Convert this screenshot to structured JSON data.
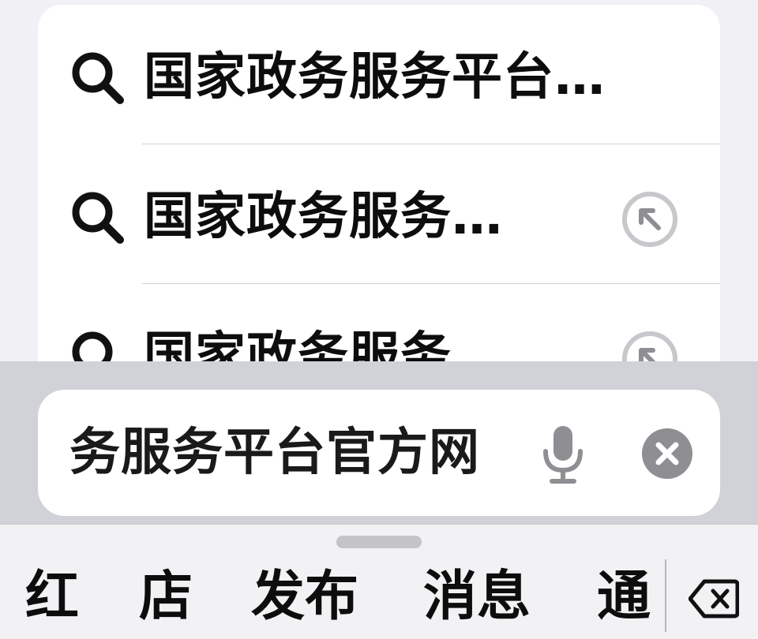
{
  "suggestions": [
    {
      "text": "国家政务服务平台…",
      "icon": "search-icon",
      "has_fill_arrow": false
    },
    {
      "text": "国家政务服务…",
      "icon": "search-icon",
      "has_fill_arrow": true
    },
    {
      "text": "国家政务服务",
      "icon": "search-icon",
      "has_fill_arrow": true
    }
  ],
  "search_field": {
    "value": "务服务平台官方网",
    "mic_icon": "microphone-icon",
    "clear_icon": "clear-icon"
  },
  "keyboard_candidates": {
    "items": [
      "红",
      "店",
      "发布",
      "消息",
      "通"
    ],
    "backspace_icon": "backspace-icon"
  },
  "colors": {
    "background": "#f0f0f5",
    "card": "#ffffff",
    "panel": "#d1d2d8",
    "icon_gray": "#8e8e93",
    "arrow_gray": "#c7c7cc"
  }
}
